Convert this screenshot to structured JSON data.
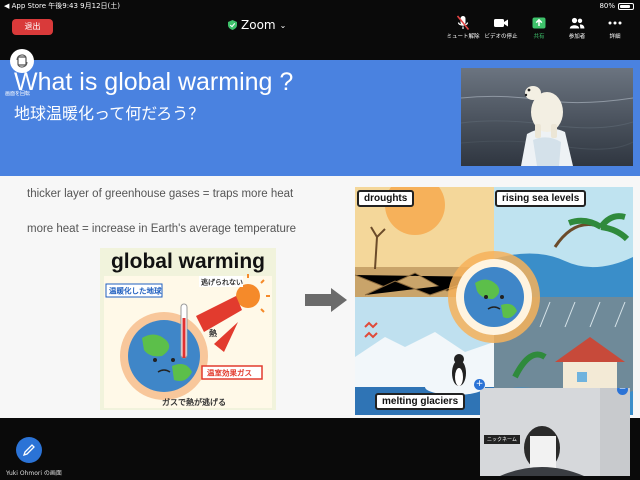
{
  "status_bar": {
    "left_text": "◀ App Store  午後9:43  9月12日(土)",
    "battery_text": "80%",
    "battery_level": 0.8
  },
  "toolbar": {
    "leave_label": "退出",
    "app_title": "Zoom",
    "tools": [
      {
        "label": "ミュート解除",
        "icon": "mic-off-icon"
      },
      {
        "label": "ビデオの停止",
        "icon": "video-icon"
      },
      {
        "label": "共有",
        "icon": "share-icon"
      },
      {
        "label": "参加者",
        "icon": "participants-icon"
      },
      {
        "label": "詳細",
        "icon": "more-icon"
      }
    ]
  },
  "rotate_label": "画面を回転",
  "slide": {
    "title_en": "What is global warming ?",
    "title_ja": "地球温暖化って何だろう？",
    "line1": "thicker layer of greenhouse gases = traps more heat",
    "line2": "more heat = increase in Earth's average temperature",
    "gw_title": "global warming",
    "gw_labels": {
      "label_earth": "温暖化した地球",
      "label_escape": "逃げられない",
      "label_heat": "熱",
      "label_gas": "温室効果ガス",
      "label_bottom": "ガスで熱が逃げる"
    },
    "illustration_labels": {
      "droughts": "droughts",
      "sea": "rising sea levels",
      "glaciers": "melting glaciers"
    }
  },
  "colors": {
    "banner": "#4a82e0",
    "leave": "#d93a3a",
    "share": "#3ec26b",
    "pencil": "#2b73d6"
  },
  "bottom": {
    "screen_owner": "Yuki Ohmori の画面",
    "self_name": "ニックネーム"
  }
}
